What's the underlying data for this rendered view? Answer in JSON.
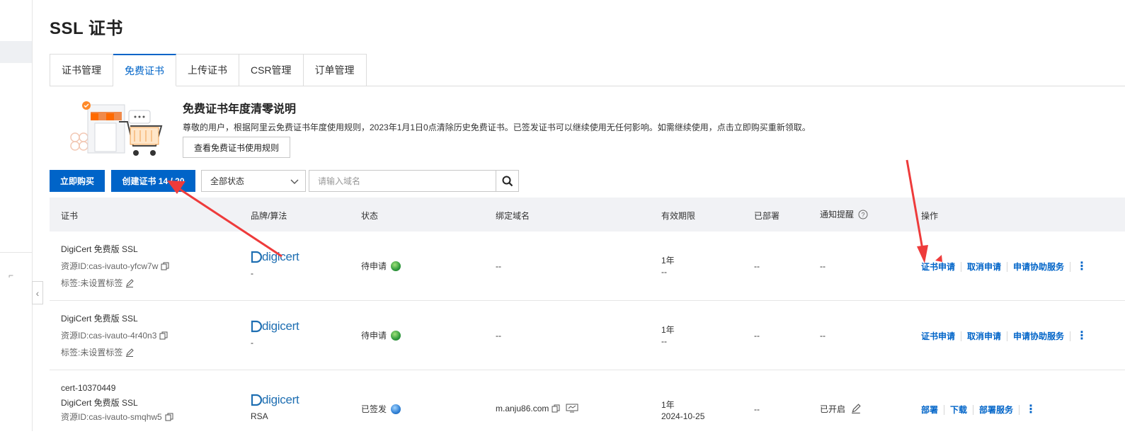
{
  "page": {
    "title": "SSL 证书"
  },
  "tabs": [
    {
      "label": "证书管理"
    },
    {
      "label": "免费证书"
    },
    {
      "label": "上传证书"
    },
    {
      "label": "CSR管理"
    },
    {
      "label": "订单管理"
    }
  ],
  "notice": {
    "title": "免费证书年度清零说明",
    "text": "尊敬的用户，根据阿里云免费证书年度使用规则，2023年1月1日0点清除历史免费证书。已签发证书可以继续使用无任何影响。如需继续使用，点击立即购买重新领取。",
    "button_label": "查看免费证书使用规则"
  },
  "toolbar": {
    "buy_label": "立即购买",
    "create_label": "创建证书 14 / 20",
    "status_selected": "全部状态",
    "search_placeholder": "请输入域名"
  },
  "table": {
    "headers": {
      "cert": "证书",
      "brand": "品牌/算法",
      "status": "状态",
      "domain": "绑定域名",
      "validity": "有效期限",
      "deployed": "已部署",
      "notify": "通知提醒",
      "ops": "操作"
    },
    "rows": [
      {
        "name": "",
        "cert_type": "DigiCert 免费版 SSL",
        "resource_id": "资源ID:cas-ivauto-yfcw7w",
        "tag": "标签:未设置标签",
        "brand": "digicert",
        "algorithm": "-",
        "status": "待申请",
        "domain": "--",
        "validity": "1年",
        "expiry": "--",
        "deployed": "--",
        "notify": "--",
        "ops": [
          "证书申请",
          "取消申请",
          "申请协助服务"
        ]
      },
      {
        "name": "",
        "cert_type": "DigiCert 免费版 SSL",
        "resource_id": "资源ID:cas-ivauto-4r40n3",
        "tag": "标签:未设置标签",
        "brand": "digicert",
        "algorithm": "-",
        "status": "待申请",
        "domain": "--",
        "validity": "1年",
        "expiry": "--",
        "deployed": "--",
        "notify": "--",
        "ops": [
          "证书申请",
          "取消申请",
          "申请协助服务"
        ]
      },
      {
        "name": "cert-10370449",
        "cert_type": "DigiCert 免费版 SSL",
        "resource_id": "资源ID:cas-ivauto-smqhw5",
        "tag": "",
        "brand": "digicert",
        "algorithm": "RSA",
        "status": "已签发",
        "domain": "m.anju86.com",
        "validity": "1年",
        "expiry": "2024-10-25",
        "deployed": "--",
        "notify": "已开启",
        "ops": [
          "部署",
          "下载",
          "部署服务"
        ]
      }
    ]
  },
  "colors": {
    "primary": "#0064c8",
    "annotation_arrow": "#ee3b3b",
    "header_bg": "#f1f2f5"
  }
}
